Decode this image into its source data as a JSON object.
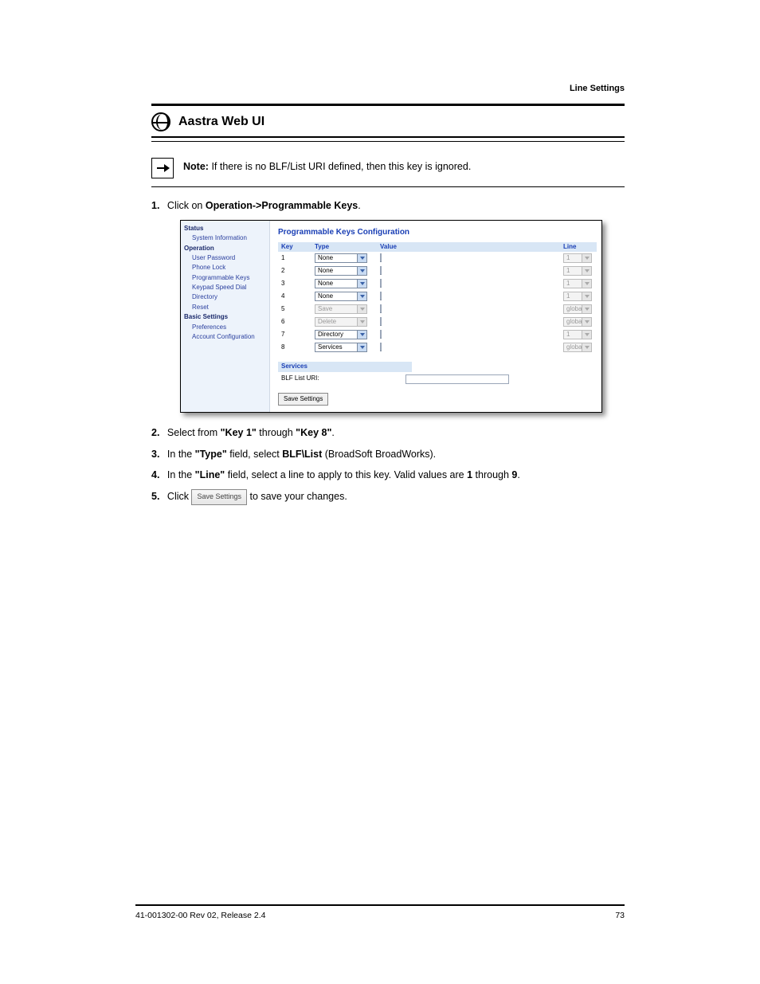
{
  "header_right": "Line Settings",
  "section_title": "Aastra Web UI",
  "note": {
    "label": "Note:",
    "text": "If there is no BLF/List URI defined, then this key is ignored."
  },
  "step1": {
    "num": "1.",
    "prefix": "Click on ",
    "bold": "Operation->Programmable Keys",
    "suffix": "."
  },
  "screenshot": {
    "title": "Programmable Keys Configuration",
    "sidebar": {
      "cat1": "Status",
      "item_sysinfo": "System Information",
      "cat2": "Operation",
      "item_userpw": "User Password",
      "item_phonelock": "Phone Lock",
      "item_progkeys": "Programmable Keys",
      "item_keypad": "Keypad Speed Dial",
      "item_directory": "Directory",
      "item_reset": "Reset",
      "cat3": "Basic Settings",
      "item_prefs": "Preferences",
      "item_acct": "Account Configuration"
    },
    "headers": {
      "key": "Key",
      "type": "Type",
      "value": "Value",
      "line": "Line"
    },
    "rows": [
      {
        "key": "1",
        "type": "None",
        "type_disabled": false,
        "line": "1",
        "line_disabled": true
      },
      {
        "key": "2",
        "type": "None",
        "type_disabled": false,
        "line": "1",
        "line_disabled": true
      },
      {
        "key": "3",
        "type": "None",
        "type_disabled": false,
        "line": "1",
        "line_disabled": true
      },
      {
        "key": "4",
        "type": "None",
        "type_disabled": false,
        "line": "1",
        "line_disabled": true
      },
      {
        "key": "5",
        "type": "Save",
        "type_disabled": true,
        "line": "global",
        "line_disabled": true
      },
      {
        "key": "6",
        "type": "Delete",
        "type_disabled": true,
        "line": "global",
        "line_disabled": true
      },
      {
        "key": "7",
        "type": "Directory",
        "type_disabled": false,
        "line": "1",
        "line_disabled": true
      },
      {
        "key": "8",
        "type": "Services",
        "type_disabled": false,
        "line": "global",
        "line_disabled": true
      }
    ],
    "services_title": "Services",
    "blf_label": "BLF List URI:",
    "save_button": "Save Settings"
  },
  "step2": {
    "num": "2.",
    "text_a": "Select from ",
    "bold_a": "\"Key 1\"",
    "text_b": " through ",
    "bold_b": "\"Key 8\"",
    "text_c": "."
  },
  "step3": {
    "num": "3.",
    "text_a": "In the ",
    "bold_a": "\"Type\"",
    "text_b": " field, select ",
    "bold_b": "BLF\\List",
    "text_c": " (BroadSoft BroadWorks)."
  },
  "step4": {
    "num": "4.",
    "text_a": "In the ",
    "bold_a": "\"Line\"",
    "text_b": " field, select a line to apply to this key. Valid values are ",
    "bold_b": "1",
    "text_c": " through ",
    "bold_c": "9",
    "text_d": "."
  },
  "step5": {
    "num": "5.",
    "text_a": "Click ",
    "btn": "Save Settings",
    "text_b": " to save your changes."
  },
  "footer": {
    "left": "41-001302-00 Rev 02, Release 2.4",
    "right": "73"
  }
}
